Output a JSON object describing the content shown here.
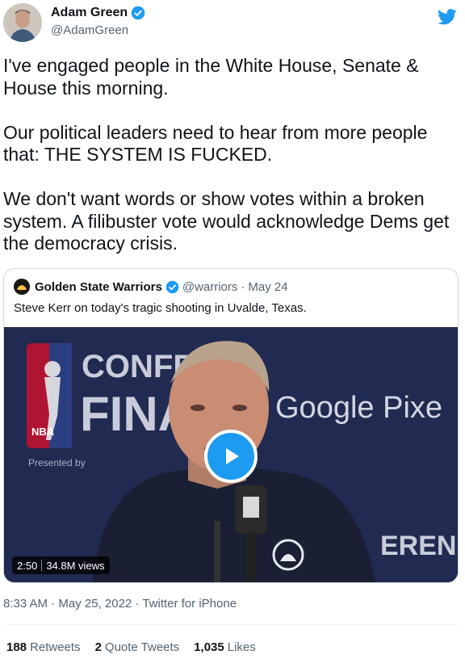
{
  "author": {
    "name": "Adam Green",
    "handle": "@AdamGreen"
  },
  "tweet": {
    "text": "I've engaged people in the White House, Senate & House this morning.\n\nOur political leaders need to hear from more people that: THE SYSTEM IS FUCKED.\n\nWe don't want words or show votes within a broken system. A filibuster vote would acknowledge Dems get the democracy crisis."
  },
  "quoted": {
    "name": "Golden State Warriors",
    "handle": "@warriors",
    "separator": "·",
    "date": "May 24",
    "text": "Steve Kerr on today's tragic shooting in Uvalde, Texas.",
    "video": {
      "duration": "2:50",
      "views": "34.8M views",
      "backdrop_text_1": "CONFER",
      "backdrop_text_2": "FINA",
      "backdrop_text_3": "Google Pixe",
      "backdrop_text_4": "ERENCE",
      "backdrop_text_5": "Presented by",
      "backdrop_text_6": "NBA"
    }
  },
  "meta": {
    "timestamp": "8:33 AM · May 25, 2022 · Twitter for iPhone"
  },
  "stats": {
    "retweets_count": "188",
    "retweets_label": "Retweets",
    "quotes_count": "2",
    "quotes_label": "Quote Tweets",
    "likes_count": "1,035",
    "likes_label": "Likes"
  },
  "colors": {
    "accent": "#1d9bf0",
    "text": "#0f1419",
    "secondary": "#536471",
    "video_bg": "#1c2343"
  },
  "icons": [
    "avatar",
    "verified-icon",
    "twitter-logo-icon",
    "play-icon"
  ]
}
